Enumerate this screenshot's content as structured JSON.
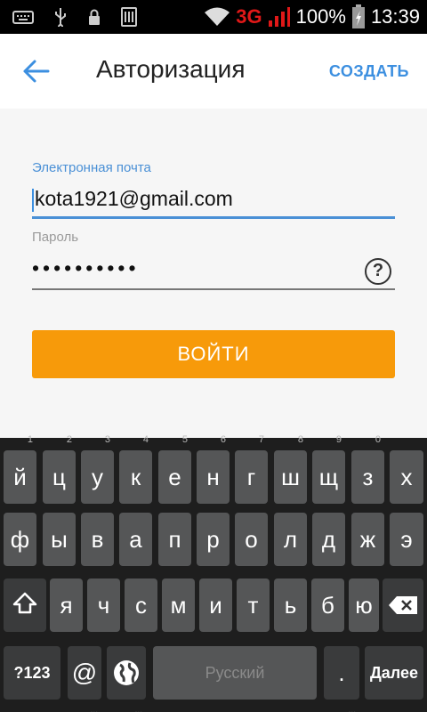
{
  "status_bar": {
    "network": "3G",
    "battery": "100%",
    "time": "13:39",
    "icons": [
      "keyboard-icon",
      "usb-icon",
      "lock-icon",
      "sim-icon",
      "wifi-icon",
      "signal-icon",
      "battery-icon"
    ]
  },
  "header": {
    "title": "Авторизация",
    "action": "СОЗДАТЬ"
  },
  "form": {
    "email_label": "Электронная почта",
    "email_value": "kota1921@gmail.com",
    "password_label": "Пароль",
    "password_value": "••••••••••",
    "help_symbol": "?",
    "login_button": "ВОЙТИ"
  },
  "keyboard": {
    "row1": [
      {
        "k": "й",
        "h": "1"
      },
      {
        "k": "ц",
        "h": "2"
      },
      {
        "k": "у",
        "h": "3"
      },
      {
        "k": "к",
        "h": "4"
      },
      {
        "k": "е",
        "h": "5"
      },
      {
        "k": "н",
        "h": "6"
      },
      {
        "k": "г",
        "h": "7"
      },
      {
        "k": "ш",
        "h": "8"
      },
      {
        "k": "щ",
        "h": "9"
      },
      {
        "k": "з",
        "h": "0"
      },
      {
        "k": "х",
        "h": ""
      }
    ],
    "row2": [
      "ф",
      "ы",
      "в",
      "а",
      "п",
      "р",
      "о",
      "л",
      "д",
      "ж",
      "э"
    ],
    "row3": [
      "я",
      "ч",
      "с",
      "м",
      "и",
      "т",
      "ь",
      "б",
      "ю"
    ],
    "symbols": "?123",
    "at": "@",
    "space": "Русский",
    "period": ".",
    "enter": "Далее",
    "colors": {
      "accent": "#4a90d6",
      "button": "#f79a0a",
      "key": "#555657"
    }
  }
}
